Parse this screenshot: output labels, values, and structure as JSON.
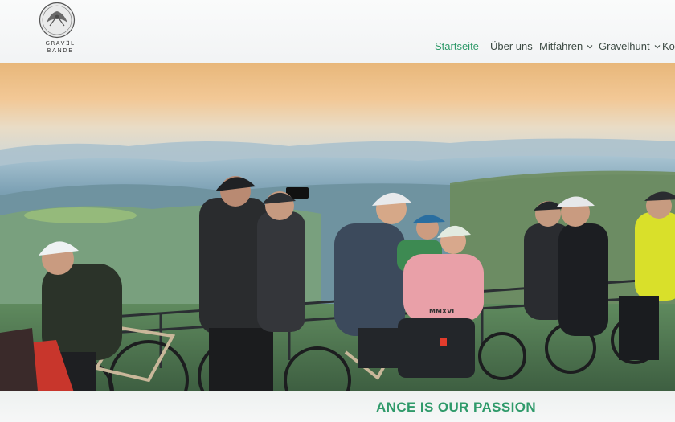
{
  "brand": {
    "logo_line1": "GRAV∃L",
    "logo_line2": "BANDE",
    "accent_color": "#2f9a6a"
  },
  "nav": {
    "items": [
      {
        "label": "Startseite",
        "active": true
      },
      {
        "label": "Über uns",
        "active": false
      },
      {
        "label": "Mitfahren",
        "active": false,
        "dropdown": true
      },
      {
        "label": "Gravelhunt",
        "active": false,
        "dropdown": true
      },
      {
        "label": "Kor",
        "active": false
      }
    ],
    "dropdown_icon": "chevron-down-icon"
  },
  "hero": {
    "jersey_text": "MMXVI"
  },
  "tagline": "ANCE IS OUR PASSION"
}
